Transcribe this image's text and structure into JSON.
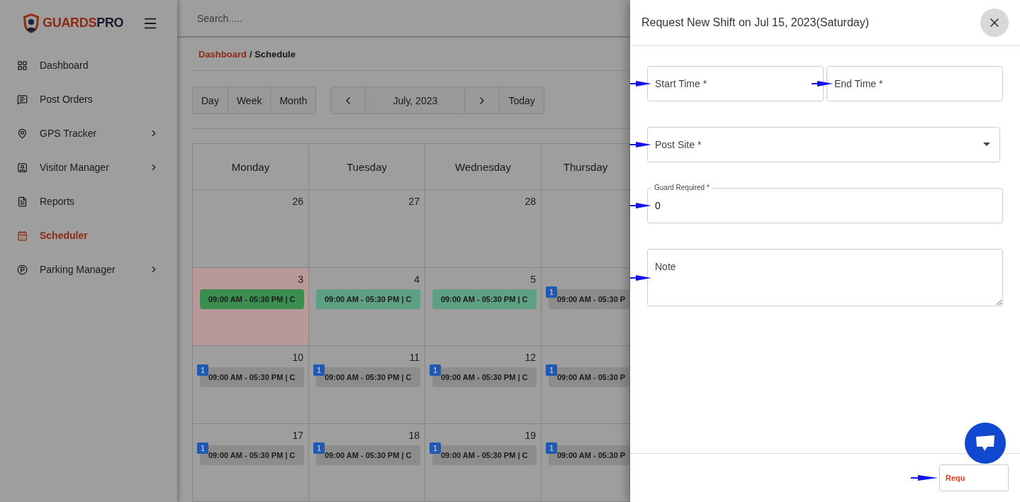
{
  "sidebar": {
    "brand_primary": "GUARDS",
    "brand_secondary": "PRO",
    "items": [
      {
        "label": "Dashboard",
        "has_submenu": false,
        "selected": false
      },
      {
        "label": "Post Orders",
        "has_submenu": false,
        "selected": false
      },
      {
        "label": "GPS Tracker",
        "has_submenu": true,
        "selected": false
      },
      {
        "label": "Visitor Manager",
        "has_submenu": true,
        "selected": false
      },
      {
        "label": "Reports",
        "has_submenu": false,
        "selected": false
      },
      {
        "label": "Scheduler",
        "has_submenu": false,
        "selected": true
      },
      {
        "label": "Parking Manager",
        "has_submenu": true,
        "selected": false
      }
    ]
  },
  "topbar": {
    "search": {
      "placeholder": "Search....."
    }
  },
  "breadcrumb": {
    "link": "Dashboard",
    "current": "/ Schedule"
  },
  "calendar": {
    "views": [
      "Day",
      "Week",
      "Month"
    ],
    "period": "July, 2023",
    "today_button": "Today",
    "weekdays": [
      "Monday",
      "Tuesday",
      "Wednesday",
      "Thursday"
    ],
    "weeks": [
      [
        {
          "date": "26",
          "today": false
        },
        {
          "date": "27",
          "today": false
        },
        {
          "date": "28",
          "today": false
        },
        {
          "today": false
        }
      ],
      [
        {
          "date": "3",
          "today": true,
          "events": [
            {
              "text": "09:00 AM - 05:30 PM | C",
              "color": "#3a8f4e"
            }
          ]
        },
        {
          "date": "4",
          "today": false,
          "events": [
            {
              "text": "09:00 AM - 05:30 PM | C",
              "color": "#5ea083"
            }
          ]
        },
        {
          "date": "5",
          "today": false,
          "events": [
            {
              "text": "09:00 AM - 05:30 PM | C",
              "color": "#5ea083"
            }
          ]
        },
        {
          "today": false,
          "events": [
            {
              "text": "09:00 AM - 05:30 P",
              "color": "#8c8c8c",
              "badge": "1"
            }
          ]
        }
      ],
      [
        {
          "date": "10",
          "today": false,
          "events": [
            {
              "text": "09:00 AM - 05:30 PM | C",
              "color": "#8c8c8c",
              "badge": "1"
            }
          ]
        },
        {
          "date": "11",
          "today": false,
          "events": [
            {
              "text": "09:00 AM - 05:30 PM | C",
              "color": "#8c8c8c",
              "badge": "1"
            }
          ]
        },
        {
          "date": "12",
          "today": false,
          "events": [
            {
              "text": "09:00 AM - 05:30 PM | C",
              "color": "#8c8c8c",
              "badge": "1"
            }
          ]
        },
        {
          "today": false,
          "events": [
            {
              "text": "09:00 AM - 05:30 P",
              "color": "#8c8c8c",
              "badge": "1"
            }
          ]
        }
      ],
      [
        {
          "date": "17",
          "today": false,
          "events": [
            {
              "text": "09:00 AM - 05:30 PM | C",
              "color": "#8c8c8c",
              "badge": "1"
            }
          ]
        },
        {
          "date": "18",
          "today": false,
          "events": [
            {
              "text": "09:00 AM - 05:30 PM | C",
              "color": "#8c8c8c",
              "badge": "1"
            }
          ]
        },
        {
          "date": "19",
          "today": false,
          "events": [
            {
              "text": "09:00 AM - 05:30 PM | C",
              "color": "#8c8c8c",
              "badge": "1"
            }
          ]
        },
        {
          "today": false,
          "events": [
            {
              "text": "09:00 AM - 05:30 P",
              "color": "#8c8c8c",
              "badge": "1"
            }
          ]
        }
      ]
    ]
  },
  "drawer": {
    "title": "Request New Shift on Jul 15, 2023(Saturday)",
    "form_rows": [
      [
        {
          "kind": "time",
          "placeholder": "Start Time *"
        },
        {
          "kind": "time",
          "placeholder": "End Time *"
        }
      ],
      [
        {
          "kind": "select",
          "placeholder": "Post Site *"
        }
      ],
      [
        {
          "kind": "number",
          "label": "Guard Required *",
          "value": "0"
        }
      ],
      [
        {
          "kind": "textarea",
          "placeholder": "Note"
        }
      ]
    ],
    "submit_button": "Requ"
  }
}
